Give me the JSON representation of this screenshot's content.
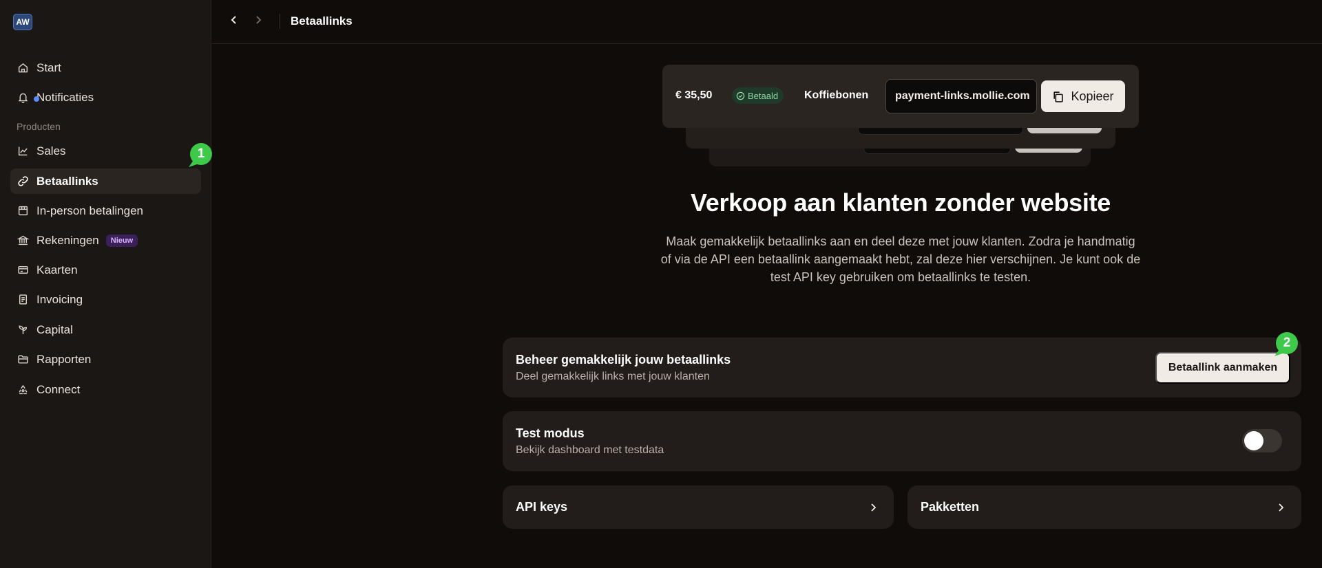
{
  "app": {
    "logo": "AW"
  },
  "topbar": {
    "title": "Betaallinks",
    "back_icon": "chevron-left-icon",
    "forward_icon": "chevron-right-icon"
  },
  "sidebar": {
    "items_top": [
      {
        "label": "Start",
        "icon": "home-icon"
      },
      {
        "label": "Notificaties",
        "icon": "bell-icon"
      }
    ],
    "section_label": "Producten",
    "items": [
      {
        "label": "Sales",
        "icon": "chart-icon"
      },
      {
        "label": "Betaallinks",
        "icon": "link-icon",
        "active": true
      },
      {
        "label": "In-person betalingen",
        "icon": "store-icon"
      },
      {
        "label": "Rekeningen",
        "icon": "bank-icon",
        "badge": "Nieuw"
      },
      {
        "label": "Kaarten",
        "icon": "card-icon"
      },
      {
        "label": "Invoicing",
        "icon": "invoice-icon"
      },
      {
        "label": "Capital",
        "icon": "sprout-icon"
      },
      {
        "label": "Rapporten",
        "icon": "folder-icon"
      },
      {
        "label": "Connect",
        "icon": "connect-icon"
      }
    ]
  },
  "preview": {
    "amount": "€ 35,50",
    "status": "Betaald",
    "product": "Koffiebonen",
    "url": "payment-links.mollie.com",
    "copy_label": "Kopieer"
  },
  "hero": {
    "title": "Verkoop aan klanten zonder website",
    "text": "Maak gemakkelijk betaallinks aan en deel deze met jouw klanten. Zodra je handmatig of via de API een betaallink aangemaakt hebt, zal deze hier verschijnen. Je kunt ook de test API key gebruiken om betaallinks te testen."
  },
  "manage": {
    "title": "Beheer gemakkelijk jouw betaallinks",
    "subtitle": "Deel gemakkelijk links met jouw klanten",
    "button": "Betaallink aanmaken"
  },
  "test_mode": {
    "title": "Test modus",
    "subtitle": "Bekijk dashboard met testdata",
    "enabled": false
  },
  "api_keys": {
    "label": "API keys"
  },
  "packages": {
    "label": "Pakketten"
  },
  "markers": [
    "1",
    "2"
  ],
  "colors": {
    "background": "#0f0c0a",
    "sidebar": "#1b1714",
    "card": "#221d1a",
    "accent_button": "#f1ebe5",
    "marker": "#3ec94a",
    "status_paid": "#8fd7a6",
    "badge_new": "#d8b4fe"
  }
}
